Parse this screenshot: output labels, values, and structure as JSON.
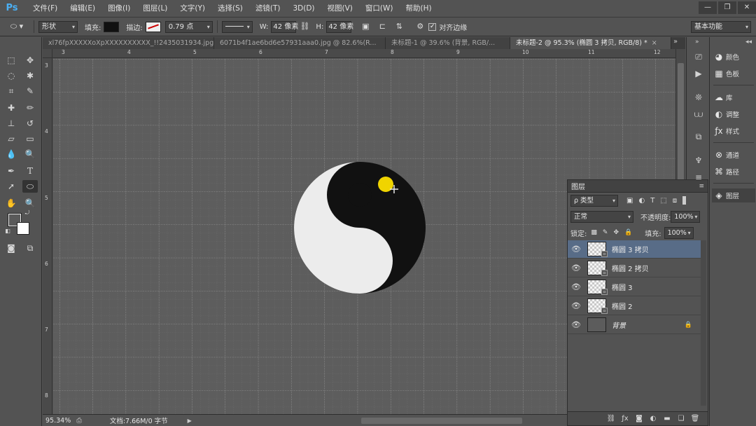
{
  "app": {
    "logo": "Ps"
  },
  "menu": [
    "文件(F)",
    "编辑(E)",
    "图像(I)",
    "图层(L)",
    "文字(Y)",
    "选择(S)",
    "滤镜(T)",
    "3D(D)",
    "视图(V)",
    "窗口(W)",
    "帮助(H)"
  ],
  "window_controls": [
    "—",
    "❐",
    "✕"
  ],
  "options": {
    "shape_mode": "形状",
    "fill_label": "填充:",
    "stroke_label": "描边:",
    "stroke_width": "0.79 点",
    "w_label": "W:",
    "w_value": "42 像素",
    "h_label": "H:",
    "h_value": "42 像素",
    "align_edges": "对齐边缘",
    "workspace": "基本功能",
    "fill_color": "#111111",
    "accent_color": "#d9d9d9"
  },
  "tabs": [
    {
      "label": "xl76fpXXXXXoXpXXXXXXXXXX_!!2435031934.jpg",
      "close": "×"
    },
    {
      "label": "6071b4f1ae6bd6e57931aaa0.jpg @ 82.6%(R...",
      "close": "×"
    },
    {
      "label": "未标题-1 @ 39.6% (背景, RGB/...",
      "close": "×"
    },
    {
      "label": "未标题-2 @ 95.3% (椭圆 3 拷贝, RGB/8) *",
      "close": "×"
    }
  ],
  "tabs_overflow": "»",
  "ruler": {
    "top": [
      "3",
      "4",
      "5",
      "6",
      "7",
      "8",
      "9",
      "10",
      "11",
      "12"
    ],
    "left": [
      "3",
      "4",
      "5",
      "6",
      "7",
      "8"
    ]
  },
  "status": {
    "zoom": "95.34%",
    "doc": "文档:7.66M/0 字节"
  },
  "panels": [
    {
      "label": "颜色",
      "icon": "palette-icon"
    },
    {
      "label": "色板",
      "icon": "swatches-icon"
    },
    {
      "label": "库",
      "icon": "library-icon"
    },
    {
      "label": "调整",
      "icon": "adjustments-icon"
    },
    {
      "label": "样式",
      "icon": "styles-icon"
    },
    {
      "label": "通道",
      "icon": "channels-icon"
    },
    {
      "label": "路径",
      "icon": "paths-icon"
    },
    {
      "label": "图层",
      "icon": "layers-icon"
    }
  ],
  "layers_panel": {
    "title": "图层",
    "filter": "ρ 类型",
    "blend_mode": "正常",
    "opacity_label": "不透明度:",
    "opacity": "100%",
    "lock_label": "锁定:",
    "fill_label": "填充:",
    "fill": "100%",
    "layers": [
      {
        "name": "椭圆 3 拷贝",
        "selected": true
      },
      {
        "name": "椭圆 2 拷贝",
        "selected": false
      },
      {
        "name": "椭圆 3",
        "selected": false
      },
      {
        "name": "椭圆 2",
        "selected": false
      },
      {
        "name": "背景",
        "selected": false
      }
    ],
    "selection_color": "#586c87"
  },
  "artwork": {
    "light": "#ececec",
    "dark": "#111111",
    "highlight": "#f0d400"
  }
}
